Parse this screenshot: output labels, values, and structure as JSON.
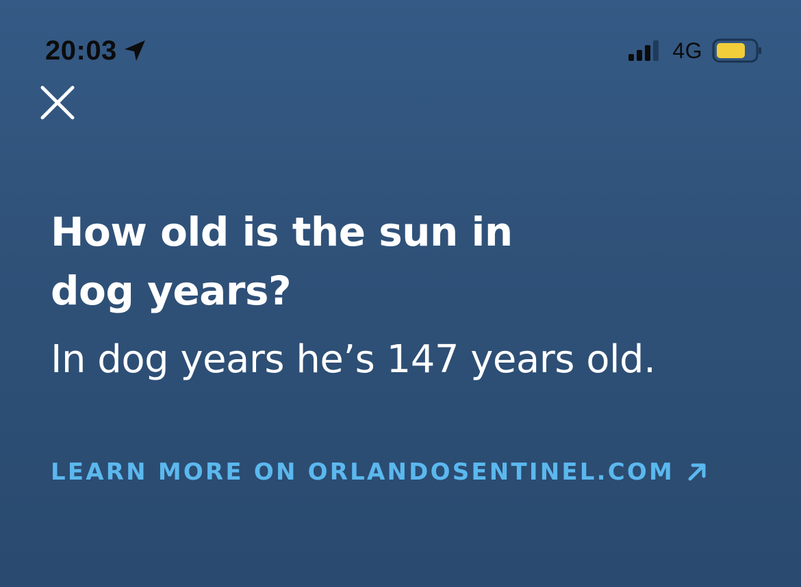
{
  "status_bar": {
    "time": "20:03",
    "network": "4G",
    "icons": {
      "location": "location-arrow-icon",
      "signal": "cellular-signal-icon",
      "battery": "battery-icon"
    },
    "battery_color": "#f2ce3b",
    "battery_level": 0.75
  },
  "card": {
    "close_icon": "close-icon",
    "question": "How old is the sun in dog years?",
    "answer": "In dog years he’s 147 years old.",
    "learn_more_label": "LEARN MORE ON ORLANDOSENTINEL.COM",
    "learn_more_icon": "arrow-up-right-icon"
  },
  "colors": {
    "background": "#2f5178",
    "text": "#ffffff",
    "link": "#5bb8ee"
  }
}
